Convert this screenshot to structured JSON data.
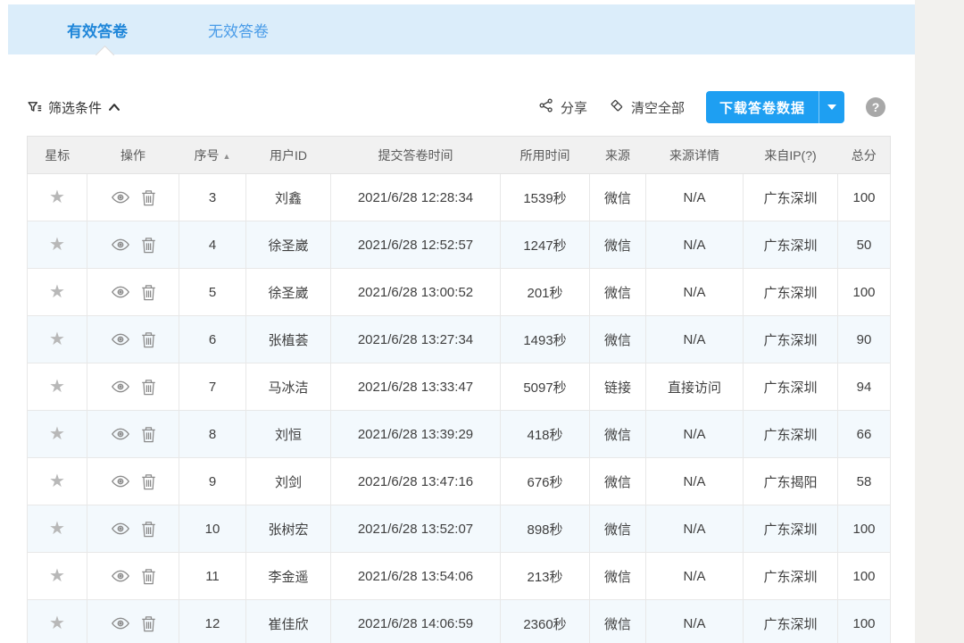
{
  "tabs": [
    {
      "label": "有效答卷",
      "active": true
    },
    {
      "label": "无效答卷",
      "active": false
    }
  ],
  "toolbar": {
    "filter_label": "筛选条件",
    "share_label": "分享",
    "clear_label": "清空全部",
    "download_label": "下载答卷数据",
    "help_label": "?"
  },
  "colors": {
    "accent_blue": "#1e9ff2",
    "tabbar_bg": "#dbedfa",
    "active_tab_text": "#1f86d9",
    "inactive_tab_text": "#4a9ce8",
    "header_row_bg": "#f1f1f1",
    "alt_row_bg": "#f3f9fd",
    "star_gray": "#b8b8b8"
  },
  "table": {
    "headers": [
      "星标",
      "操作",
      "序号",
      "用户ID",
      "提交答卷时间",
      "所用时间",
      "来源",
      "来源详情",
      "来自IP(?)",
      "总分"
    ],
    "sorted_column_index": 2,
    "sort_direction": "asc",
    "rows": [
      {
        "seq": "3",
        "user": "刘鑫",
        "time": "2021/6/28 12:28:34",
        "duration": "1539秒",
        "source": "微信",
        "source_detail": "N/A",
        "ip": "广东深圳",
        "score": "100"
      },
      {
        "seq": "4",
        "user": "徐圣崴",
        "time": "2021/6/28 12:52:57",
        "duration": "1247秒",
        "source": "微信",
        "source_detail": "N/A",
        "ip": "广东深圳",
        "score": "50"
      },
      {
        "seq": "5",
        "user": "徐圣崴",
        "time": "2021/6/28 13:00:52",
        "duration": "201秒",
        "source": "微信",
        "source_detail": "N/A",
        "ip": "广东深圳",
        "score": "100"
      },
      {
        "seq": "6",
        "user": "张植荟",
        "time": "2021/6/28 13:27:34",
        "duration": "1493秒",
        "source": "微信",
        "source_detail": "N/A",
        "ip": "广东深圳",
        "score": "90"
      },
      {
        "seq": "7",
        "user": "马冰洁",
        "time": "2021/6/28 13:33:47",
        "duration": "5097秒",
        "source": "链接",
        "source_detail": "直接访问",
        "ip": "广东深圳",
        "score": "94"
      },
      {
        "seq": "8",
        "user": "刘恒",
        "time": "2021/6/28 13:39:29",
        "duration": "418秒",
        "source": "微信",
        "source_detail": "N/A",
        "ip": "广东深圳",
        "score": "66"
      },
      {
        "seq": "9",
        "user": "刘剑",
        "time": "2021/6/28 13:47:16",
        "duration": "676秒",
        "source": "微信",
        "source_detail": "N/A",
        "ip": "广东揭阳",
        "score": "58"
      },
      {
        "seq": "10",
        "user": "张树宏",
        "time": "2021/6/28 13:52:07",
        "duration": "898秒",
        "source": "微信",
        "source_detail": "N/A",
        "ip": "广东深圳",
        "score": "100"
      },
      {
        "seq": "11",
        "user": "李金遥",
        "time": "2021/6/28 13:54:06",
        "duration": "213秒",
        "source": "微信",
        "source_detail": "N/A",
        "ip": "广东深圳",
        "score": "100"
      },
      {
        "seq": "12",
        "user": "崔佳欣",
        "time": "2021/6/28 14:06:59",
        "duration": "2360秒",
        "source": "微信",
        "source_detail": "N/A",
        "ip": "广东深圳",
        "score": "100"
      }
    ]
  }
}
